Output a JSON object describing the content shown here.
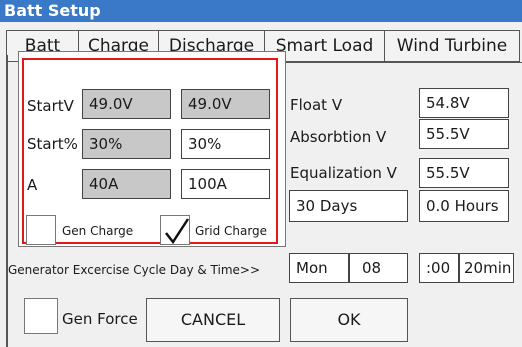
{
  "window": {
    "title": "Batt Setup"
  },
  "tabs": [
    {
      "label": "Batt"
    },
    {
      "label": "Charge"
    },
    {
      "label": "Discharge"
    },
    {
      "label": "Smart Load"
    },
    {
      "label": "Wind Turbine"
    }
  ],
  "charge_group": {
    "rows": [
      {
        "label": "StartV",
        "left_value": "49.0V",
        "right_value": "49.0V"
      },
      {
        "label": "Start%",
        "left_value": "30%",
        "right_value": "30%"
      },
      {
        "label": "A",
        "left_value": "40A",
        "right_value": "100A"
      }
    ],
    "gen_charge": {
      "label": "Gen Charge",
      "checked": false
    },
    "grid_charge": {
      "label": "Grid Charge",
      "checked": true
    }
  },
  "right_panel": {
    "float_v": {
      "label": "Float V",
      "value": "54.8V"
    },
    "absorption_v": {
      "label": "Absorbtion V",
      "value": "55.5V"
    },
    "equalization_v": {
      "label": "Equalization V",
      "value": "55.5V"
    },
    "equalization_interval": "30 Days",
    "equalization_duration": "0.0 Hours"
  },
  "generator_exercise": {
    "label": "Generator Excercise Cycle Day & Time>>",
    "day": "Mon",
    "hour": "08",
    "minute": ":00",
    "duration": "20min"
  },
  "gen_force": {
    "label": "Gen Force",
    "checked": false
  },
  "buttons": {
    "cancel": "CANCEL",
    "ok": "OK"
  },
  "colors": {
    "title_bar": "#3a78c8",
    "highlight_border": "#e01818",
    "readonly_field": "#c8c8c8"
  }
}
